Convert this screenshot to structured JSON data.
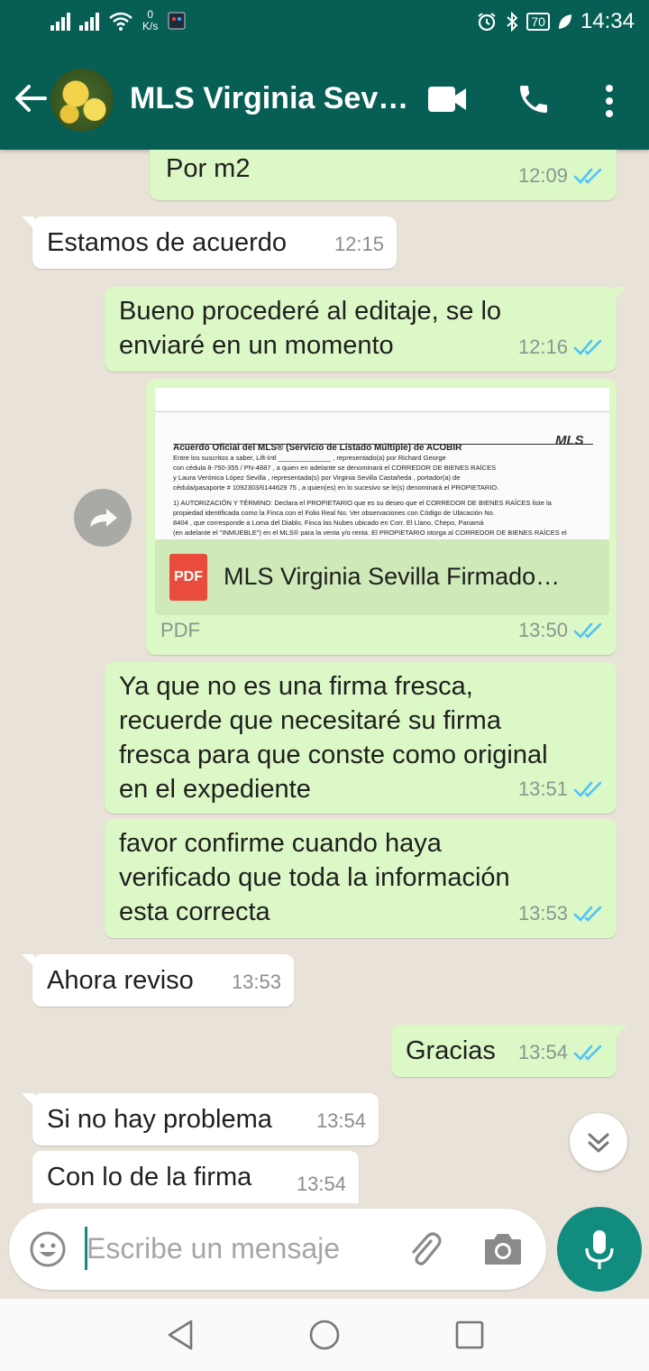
{
  "status_bar": {
    "speed_value": "0",
    "speed_unit": "K/s",
    "battery": "70",
    "time": "14:34"
  },
  "header": {
    "contact_name": "MLS Virginia Sev…",
    "icons": [
      "back-arrow-icon",
      "video-call-icon",
      "phone-icon",
      "more-options-icon"
    ]
  },
  "messages": [
    {
      "direction": "out",
      "text": "Por m2",
      "time": "12:09",
      "status": "read"
    },
    {
      "direction": "in",
      "text": "Estamos de acuerdo",
      "time": "12:15"
    },
    {
      "direction": "out",
      "text_lines": [
        "Bueno procederé al editaje, se lo",
        "enviaré en un momento"
      ],
      "time": "12:16",
      "status": "read"
    },
    {
      "direction": "out",
      "type": "document",
      "file_name": "MLS Virginia Sevilla Firmado…",
      "file_type": "PDF",
      "icon_label": "PDF",
      "time": "13:50",
      "status": "read",
      "preview": {
        "heading": "Acuerdo Oficial del MLS® (Servicio de Listado Múltiple) de ACOBIR",
        "logo": "MLS",
        "lines": [
          "Entre los suscritos a saber, Lift-Intl ______________ , representado(a) por Richard George",
          "con cédula 8-750-355 / PN-4887 , a quien en adelante se denominará el CORREDOR DE BIENES RAÍCES",
          "y Laura Verónica López Sevilla , representada(s) por Virginia Sevilla Castañeda , portador(a) de",
          "cédula/pasaporte # 1092303/6144629 75 , a quien(es) en lo sucesivo se le(s) denominará el PROPIETARIO.",
          "1) AUTORIZACIÓN Y TÉRMINO: Declara el PROPIETARIO que es su deseo que el CORREDOR DE BIENES RAÍCES liste la",
          "propiedad identificada como la Finca con el Folio Real No. Ver observaciones con Código de Ubicación No.",
          "8404 , que corresponde a Loma del Diablo, Finca las Nubes ubicado en Corr. El Llano, Chepo, Panamá",
          "(en adelante el \"INMUEBLE\") en el MLS® para la venta y/o renta. El PROPIETARIO otorga al CORREDOR DE BIENES RAÍCES el"
        ]
      }
    },
    {
      "direction": "out",
      "text_lines": [
        "Ya que no es una firma fresca,",
        "recuerde que necesitaré su firma",
        "fresca para que conste como original",
        "en el expediente"
      ],
      "time": "13:51",
      "status": "read"
    },
    {
      "direction": "out",
      "text_lines": [
        "favor confirme cuando haya",
        "verificado que toda la información",
        "esta correcta"
      ],
      "time": "13:53",
      "status": "read"
    },
    {
      "direction": "in",
      "text": "Ahora reviso",
      "time": "13:53"
    },
    {
      "direction": "out",
      "text": "Gracias",
      "time": "13:54",
      "status": "read"
    },
    {
      "direction": "in",
      "text": "Si no hay problema",
      "time": "13:54"
    },
    {
      "direction": "in",
      "text": "Con lo de la firma",
      "time": "13:54"
    }
  ],
  "input": {
    "placeholder": "Escribe un mensaje"
  },
  "colors": {
    "header": "#075e54",
    "outgoing_bubble": "#dcf8c6",
    "incoming_bubble": "#ffffff",
    "read_ticks": "#4fc3f7",
    "mic_button": "#128c7e",
    "chat_background": "#e9e2d8"
  }
}
